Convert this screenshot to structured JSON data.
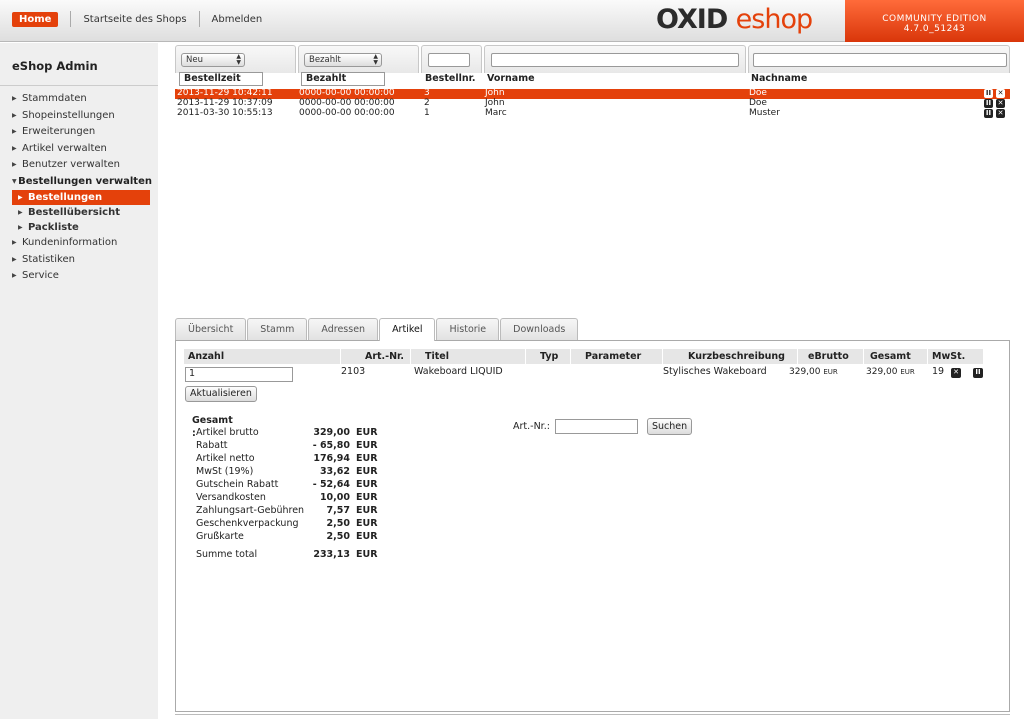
{
  "topnav": {
    "home": "Home",
    "shop_start": "Startseite des Shops",
    "logout": "Abmelden"
  },
  "logo": {
    "part1": "OXID",
    "part2": "eshop"
  },
  "edition": {
    "line1": "COMMUNITY EDITION",
    "line2": "4.7.0_51243"
  },
  "sidebar": {
    "title": "eShop Admin",
    "items": [
      "Stammdaten",
      "Shopeinstellungen",
      "Erweiterungen",
      "Artikel verwalten",
      "Benutzer verwalten",
      "Bestellungen verwalten",
      "Bestellungen",
      "Bestellübersicht",
      "Packliste",
      "Kundeninformation",
      "Statistiken",
      "Service"
    ]
  },
  "list": {
    "filters": {
      "status": "Neu",
      "paid": "Bezahlt"
    },
    "headers": {
      "ordertime": "Bestellzeit",
      "paid": "Bezahlt",
      "ordernr": "Bestellnr.",
      "firstname": "Vorname",
      "lastname": "Nachname"
    },
    "rows": [
      {
        "time": "2013-11-29 10:42:11",
        "paid": "0000-00-00 00:00:00",
        "nr": "3",
        "first": "John",
        "last": "Doe"
      },
      {
        "time": "2013-11-29 10:37:09",
        "paid": "0000-00-00 00:00:00",
        "nr": "2",
        "first": "John",
        "last": "Doe"
      },
      {
        "time": "2011-03-30 10:55:13",
        "paid": "0000-00-00 00:00:00",
        "nr": "1",
        "first": "Marc",
        "last": "Muster"
      }
    ]
  },
  "tabs": [
    "Übersicht",
    "Stamm",
    "Adressen",
    "Artikel",
    "Historie",
    "Downloads"
  ],
  "articles": {
    "headers": {
      "qty": "Anzahl",
      "artnr": "Art.-Nr.",
      "title": "Titel",
      "type": "Typ",
      "params": "Parameter",
      "short": "Kurzbeschreibung",
      "brutto": "eBrutto",
      "total": "Gesamt",
      "vat": "MwSt."
    },
    "row": {
      "qty": "1",
      "artnr": "2103",
      "title": "Wakeboard LIQUID",
      "short": "Stylisches Wakeboard",
      "brutto": "329,00",
      "brutto_cur": "EUR",
      "total": "329,00",
      "total_cur": "EUR",
      "vat": "19"
    },
    "update_button": "Aktualisieren"
  },
  "totals": {
    "heading": "Gesamt :",
    "lines": [
      {
        "label": "Artikel brutto",
        "value": "329,00",
        "cur": "EUR"
      },
      {
        "label": "Rabatt",
        "value": "- 65,80",
        "cur": "EUR"
      },
      {
        "label": "Artikel netto",
        "value": "176,94",
        "cur": "EUR"
      },
      {
        "label": "MwSt (19%)",
        "value": "33,62",
        "cur": "EUR"
      },
      {
        "label": "Gutschein Rabatt",
        "value": "- 52,64",
        "cur": "EUR"
      },
      {
        "label": "Versandkosten",
        "value": "10,00",
        "cur": "EUR"
      },
      {
        "label": "Zahlungsart-Gebühren",
        "value": "7,57",
        "cur": "EUR"
      },
      {
        "label": "Geschenkverpackung",
        "value": "2,50",
        "cur": "EUR"
      },
      {
        "label": "Grußkarte",
        "value": "2,50",
        "cur": "EUR"
      }
    ],
    "sum": {
      "label": "Summe total",
      "value": "233,13",
      "cur": "EUR"
    }
  },
  "search": {
    "label": "Art.-Nr.:",
    "value": "",
    "button": "Suchen"
  },
  "colors": {
    "accent": "#e4410b"
  }
}
